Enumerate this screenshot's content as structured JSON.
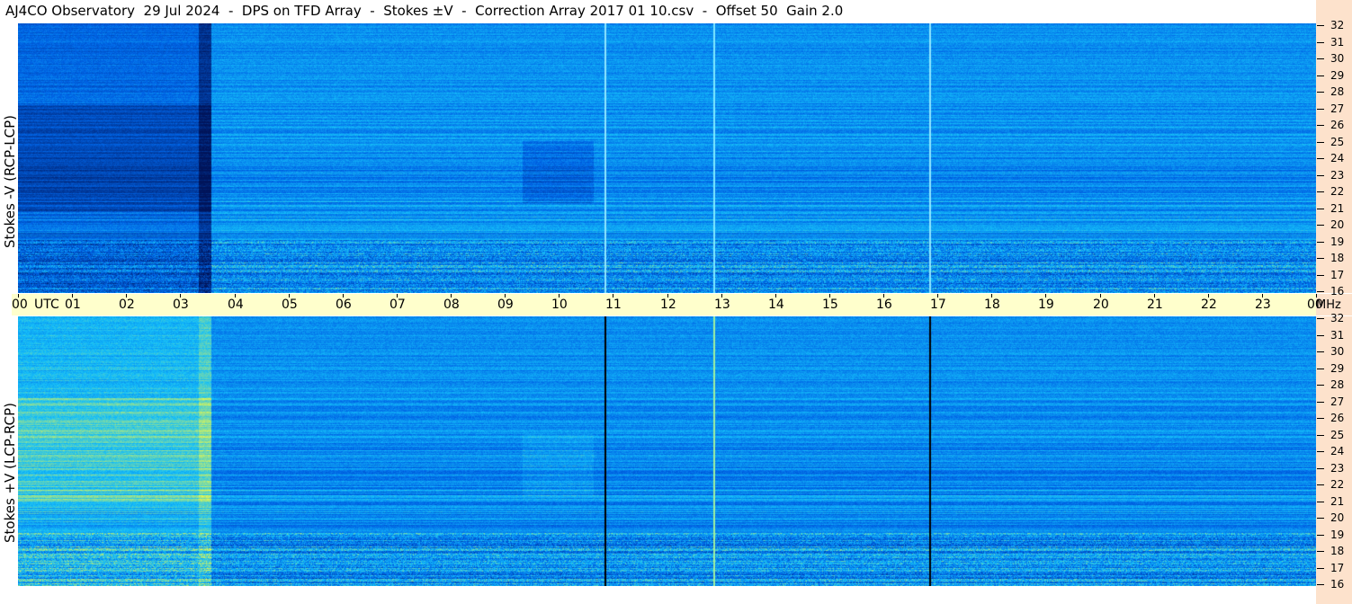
{
  "title": "AJ4CO Observatory  29 Jul 2024  -  DPS on TFD Array  -  Stokes ±V  -  Correction Array 2017 01 10.csv  -  Offset 50  Gain 2.0",
  "chart_data": {
    "type": "heatmap",
    "title": "AJ4CO Observatory  29 Jul 2024  -  DPS on TFD Array  -  Stokes ±V  -  Correction Array 2017 01 10.csv  -  Offset 50  Gain 2.0",
    "x_axis": {
      "unit": "UTC",
      "ticks": [
        "00",
        "01",
        "02",
        "03",
        "04",
        "05",
        "06",
        "07",
        "08",
        "09",
        "10",
        "11",
        "12",
        "13",
        "14",
        "15",
        "16",
        "17",
        "18",
        "19",
        "20",
        "21",
        "22",
        "23",
        "00"
      ],
      "range": [
        0,
        24
      ]
    },
    "y_axis": {
      "unit": "MHz",
      "ticks": [
        "32",
        "31",
        "30",
        "29",
        "28",
        "27",
        "26",
        "25",
        "24",
        "23",
        "22",
        "21",
        "20",
        "19",
        "18",
        "17",
        "16"
      ],
      "range": [
        16,
        32
      ]
    },
    "panels": [
      {
        "name": "Stokes -V (RCP-LCP)"
      },
      {
        "name": "Stokes +V (LCP-RCP)"
      }
    ],
    "colors": {
      "background": "#1e6be8",
      "time_band": "#ffffcc",
      "freq_band": "#fde2cc"
    }
  }
}
